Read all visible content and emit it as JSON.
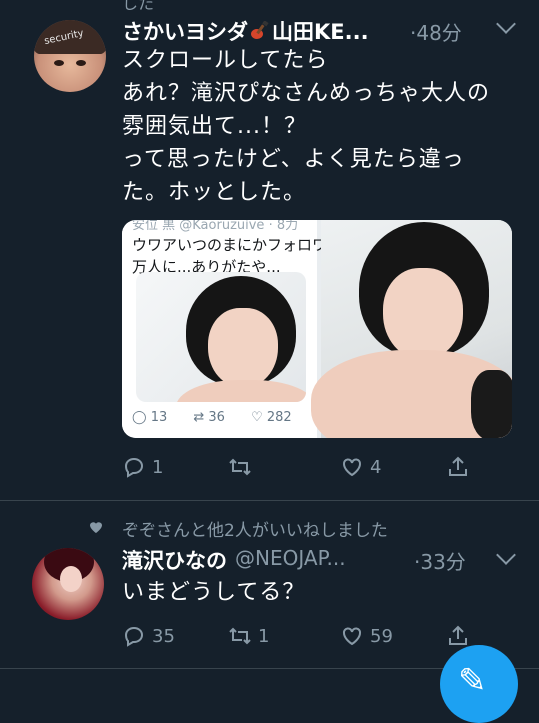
{
  "partial_top_text": "した",
  "tweet1": {
    "name_before": "さかいヨシダ",
    "name_after": "山田KE...",
    "time": "48分",
    "avatar_text": "security",
    "lines": "スクロールしてたら\nあれ？滝沢ぴなさんめっちゃ大人の\n雰囲気出て...！？\nって思ったけど、よく見たら違っ\nた。ホッとした。",
    "embed": {
      "top_cut": "安位 黒 @Kaoruzuive · 8力",
      "line1": "ウワアいつのまにかフォロワ",
      "line2": "万人に...ありがたや...",
      "reply_count": "13",
      "retweet_count": "36",
      "like_count": "282"
    },
    "actions": {
      "reply": "1",
      "retweet": "",
      "like": "4"
    }
  },
  "liked_by": "ぞぞさんと他2人がいいねしました",
  "tweet2": {
    "name": "滝沢ひなの",
    "handle": "@NEOJAP...",
    "time": "·33分",
    "text": "いまどうしてる？",
    "actions": {
      "reply": "35",
      "retweet": "1",
      "like": "59"
    }
  },
  "icons": [
    "reply-icon",
    "retweet-icon",
    "like-icon",
    "share-icon",
    "chevron-down-icon",
    "heart-icon",
    "compose-icon",
    "guitar-emoji-icon"
  ]
}
